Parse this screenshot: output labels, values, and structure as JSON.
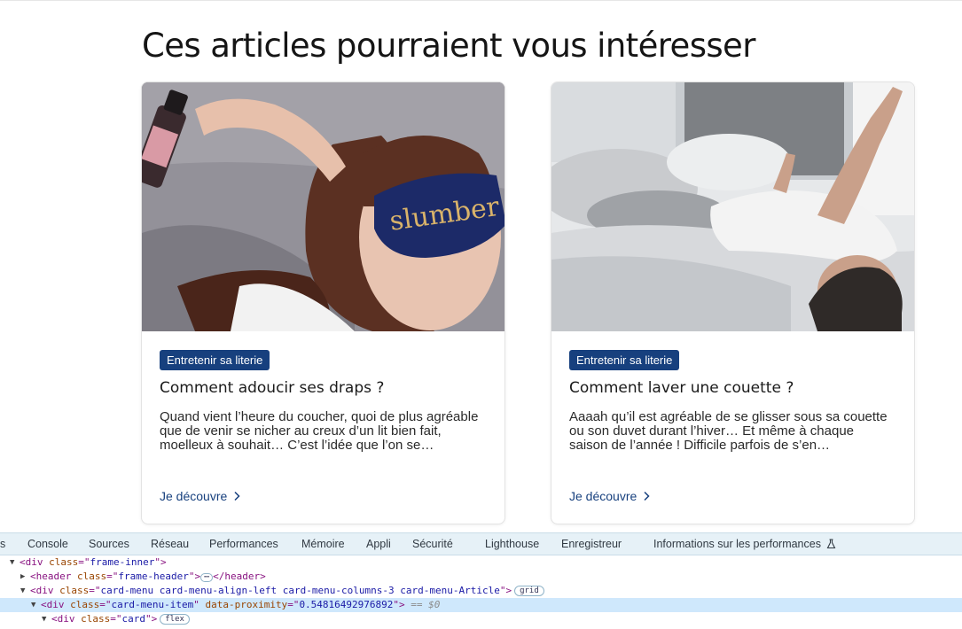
{
  "page": {
    "section_title": "Ces articles pourraient vous intéresser",
    "cards": [
      {
        "image_alt": "Femme dormant avec un masque slumber",
        "mask_text": "slumber",
        "badge": "Entretenir sa literie",
        "title": "Comment adoucir ses draps ?",
        "excerpt": "Quand vient l’heure du coucher, quoi de plus agréable que de venir se nicher au creux d’un lit bien fait, moelleux à souhait… C’est l’idée que l’on se…",
        "link": "Je découvre"
      },
      {
        "image_alt": "Homme allongé sur un lit",
        "badge": "Entretenir sa literie",
        "title": "Comment laver une couette ?",
        "excerpt": "Aaaah qu’il est agréable de se glisser sous sa couette ou son duvet durant l’hiver… Et même à chaque saison de l’année ! Difficile parfois de s’en…",
        "link": "Je découvre"
      }
    ]
  },
  "devtools": {
    "tabs": [
      "s",
      "Console",
      "Sources",
      "Réseau",
      "Performances",
      "Mémoire",
      "Appli",
      "Sécurité",
      "Lighthouse",
      "Enregistreur",
      "Informations sur les performances"
    ],
    "dom": {
      "l1": {
        "tag": "div",
        "attr": "class",
        "val": "frame-inner"
      },
      "l2": {
        "tag": "header",
        "attr": "class",
        "val": "frame-header",
        "close": "</header>"
      },
      "l3": {
        "tag": "div",
        "attr": "class",
        "val": "card-menu card-menu-align-left card-menu-columns-3 card-menu-Article",
        "pill": "grid"
      },
      "l4": {
        "tag": "div",
        "attr": "class",
        "val": "card-menu-item",
        "attr2": "data-proximity",
        "val2": "0.54816492976892",
        "marker": "== $0"
      },
      "l5": {
        "tag": "div",
        "attr": "class",
        "val": "card",
        "pill": "flex"
      }
    }
  },
  "colors": {
    "badge_bg": "#17407e",
    "link": "#17407e",
    "devtools_tabbar": "#e6f1f7",
    "selected_row": "#cfe8fc"
  }
}
